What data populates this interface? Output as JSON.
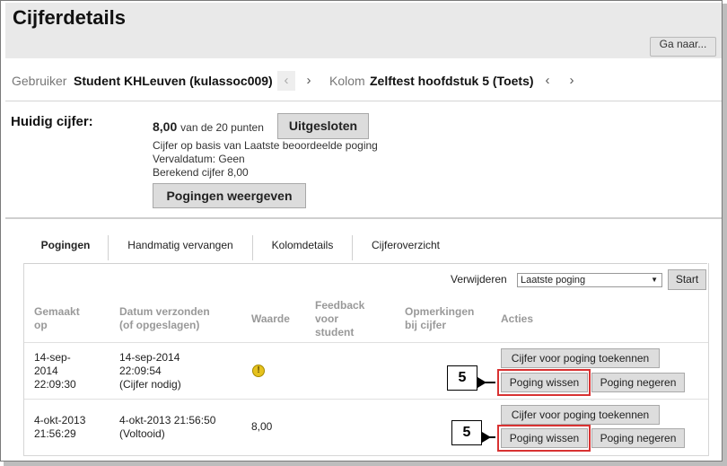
{
  "page": {
    "title": "Cijferdetails",
    "goto_label": "Ga naar..."
  },
  "nav": {
    "user_label": "Gebruiker",
    "user_value": "Student KHLeuven (kulassoc009)",
    "column_label": "Kolom",
    "column_value": "Zelftest hoofdstuk 5 (Toets)",
    "prev_glyph": "‹",
    "next_glyph": "›"
  },
  "current": {
    "label": "Huidig cijfer:",
    "score": "8,00",
    "score_suffix": "van de 20 punten",
    "excluded_button": "Uitgesloten",
    "line1": "Cijfer op basis van Laatste beoordeelde poging",
    "line2": "Vervaldatum: Geen",
    "line3": "Berekend cijfer  8,00",
    "view_attempts_button": "Pogingen weergeven"
  },
  "tabs": [
    {
      "label": "Pogingen",
      "active": true
    },
    {
      "label": "Handmatig vervangen",
      "active": false
    },
    {
      "label": "Kolomdetails",
      "active": false
    },
    {
      "label": "Cijferoverzicht",
      "active": false
    }
  ],
  "toolbar": {
    "delete_label": "Verwijderen",
    "select_value": "Laatste poging",
    "start_button": "Start"
  },
  "table": {
    "headers": {
      "made_1": "Gemaakt",
      "made_2": "op",
      "sent_1": "Datum verzonden",
      "sent_2": "(of opgeslagen)",
      "value": "Waarde",
      "feedback_1": "Feedback",
      "feedback_2": "voor",
      "feedback_3": "student",
      "remarks_1": "Opmerkingen",
      "remarks_2": "bij cijfer",
      "actions": "Acties"
    },
    "rows": [
      {
        "made_1": "14-sep-",
        "made_2": "2014",
        "made_3": "22:09:30",
        "sent_1": "14-sep-2014",
        "sent_2": "22:09:54",
        "sent_3": "(Cijfer nodig)",
        "value_icon": "warning-icon",
        "grade_button": "Cijfer voor poging toekennen",
        "clear_button": "Poging wissen",
        "ignore_button": "Poging negeren",
        "callout": "5"
      },
      {
        "made_1": "4-okt-2013",
        "made_2": "21:56:29",
        "sent_1": "4-okt-2013 21:56:50",
        "sent_2": "(Voltooid)",
        "value": "8,00",
        "grade_button": "Cijfer voor poging toekennen",
        "clear_button": "Poging wissen",
        "ignore_button": "Poging negeren",
        "callout": "5"
      }
    ]
  },
  "colors": {
    "highlight": "#d83232",
    "warning": "#e6c21e",
    "header_bg": "#e9e9e9"
  }
}
